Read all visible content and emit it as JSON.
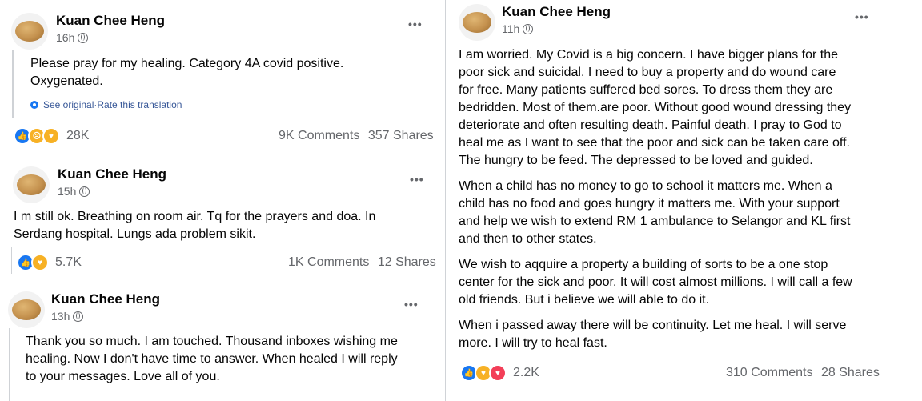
{
  "posts": [
    {
      "author": "Kuan Chee Heng",
      "time": "16h",
      "text": [
        "Please pray for my healing. Category 4A covid positive.",
        "Oxygenated."
      ],
      "translation": {
        "see_original": "See original",
        "separator": " · ",
        "rate": "Rate this translation"
      },
      "reaction_count": "28K",
      "comments": "9K Comments",
      "shares": "357 Shares",
      "reactions": [
        "like-icon",
        "sad-icon",
        "care-icon"
      ]
    },
    {
      "author": "Kuan Chee Heng",
      "time": "15h",
      "text": [
        "I m still ok. Breathing on room air. Tq for the prayers and doa. In",
        "Serdang hospital. Lungs ada problem sikit."
      ],
      "reaction_count": "5.7K",
      "comments": "1K Comments",
      "shares": "12 Shares",
      "reactions": [
        "like-icon",
        "care-icon"
      ]
    },
    {
      "author": "Kuan Chee Heng",
      "time": "13h",
      "text": [
        "Thank you so much. I am touched. Thousand inboxes wishing me",
        "healing. Now I don't have time to answer. When healed I will reply",
        "to your messages. Love all of you."
      ]
    },
    {
      "author": "Kuan Chee Heng",
      "time": "11h",
      "paragraphs": [
        [
          "I am worried. My Covid is a big concern. I have bigger plans for the",
          "poor sick  and suicidal. I need to buy a property and do wound care",
          "for free. Many patients suffered bed sores. To dress them they are",
          "bedridden. Most of them.are poor. Without good wound dressing they",
          "deteriorate and often resulting death. Painful death. I pray to God to",
          "heal me as I want to see that the poor and sick can be taken care off.",
          "The hungry to be feed. The depressed to be loved and guided."
        ],
        [
          "When a child has no money to go to school it matters me. When a",
          "child has no food and goes hungry it matters me. With your support",
          "and help we wish to extend RM 1  ambulance to Selangor and KL first",
          "and then to other states."
        ],
        [
          "We wish to aqquire a property a building of sorts to be a one stop",
          "center for the sick and poor. It will cost almost millions.  I will call a few",
          "old friends. But i believe we will able to do it."
        ],
        [
          "When i passed away there will be continuity. Let me heal. I will serve",
          "more. I will try to heal fast."
        ]
      ],
      "reaction_count": "2.2K",
      "comments": "310 Comments",
      "shares": "28 Shares",
      "reactions": [
        "like-icon",
        "care-icon",
        "love-icon"
      ]
    }
  ],
  "more_label": "•••",
  "colors": {
    "accent": "#1877f2",
    "secondary_text": "#65676b",
    "love": "#f33e58",
    "emoji": "#f7b125"
  }
}
